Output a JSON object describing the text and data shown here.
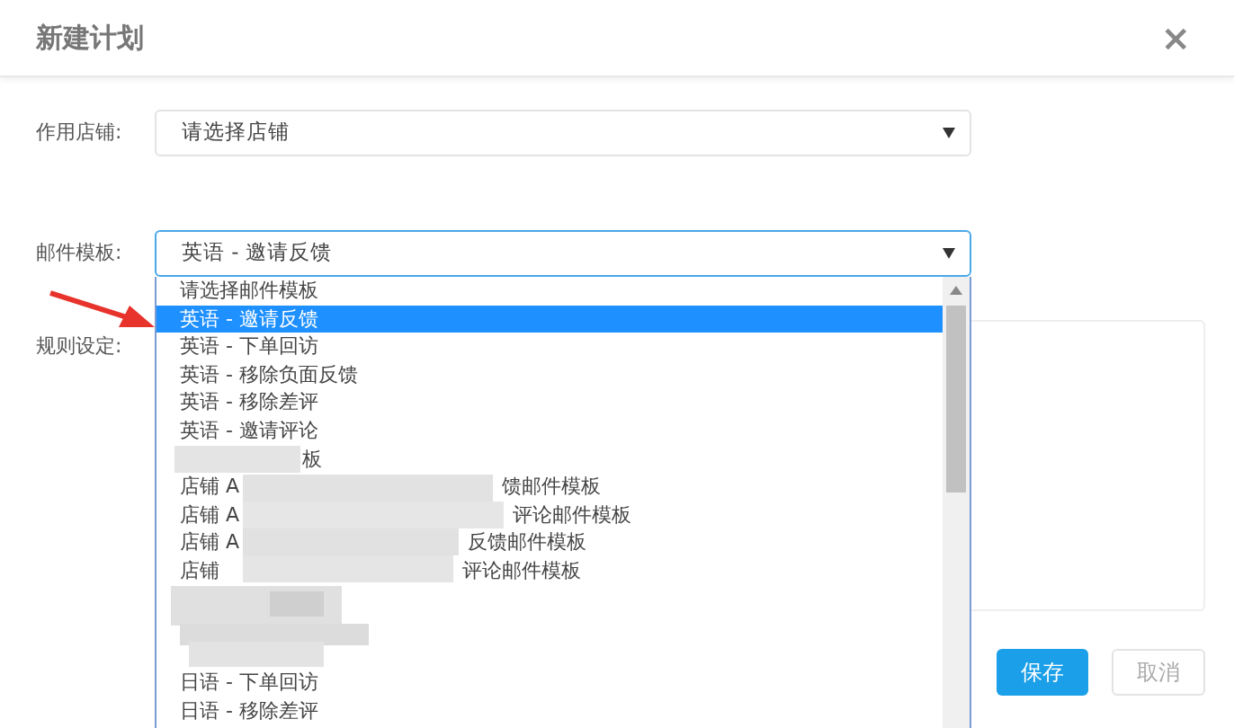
{
  "dialog": {
    "title": "新建计划",
    "close": "×"
  },
  "fields": [
    {
      "label": "作用店铺:",
      "value": "请选择店铺",
      "focused": false
    },
    {
      "label": "邮件模板:",
      "value": "英语 - 邀请反馈",
      "focused": true
    }
  ],
  "dropdown": {
    "items": [
      {
        "kind": "text",
        "text": "请选择邮件模板",
        "selected": false
      },
      {
        "kind": "text",
        "text": "英语 - 邀请反馈",
        "selected": true
      },
      {
        "kind": "text",
        "text": "英语 - 下单回访",
        "selected": false
      },
      {
        "kind": "text",
        "text": "英语 - 移除负面反馈",
        "selected": false
      },
      {
        "kind": "text",
        "text": "英语 - 移除差评",
        "selected": false
      },
      {
        "kind": "text",
        "text": "英语 - 邀请评论",
        "selected": false
      },
      {
        "kind": "partial",
        "right": "板",
        "selected": false
      },
      {
        "kind": "partial",
        "left": "店铺 A",
        "right": "馈邮件模板",
        "selected": false
      },
      {
        "kind": "partial",
        "left": "店铺 A",
        "right": "评论邮件模板",
        "selected": false
      },
      {
        "kind": "partial",
        "left": "店铺 A",
        "right": "反馈邮件模板",
        "selected": false
      },
      {
        "kind": "partial",
        "left": "店铺",
        "right": "评论邮件模板",
        "selected": false
      },
      {
        "kind": "hidden",
        "selected": false
      },
      {
        "kind": "hidden",
        "selected": false
      },
      {
        "kind": "hidden",
        "selected": false
      },
      {
        "kind": "text",
        "text": "日语 - 下单回访",
        "selected": false
      },
      {
        "kind": "text",
        "text": "日语 - 移除差评",
        "selected": false
      }
    ]
  },
  "rules": {
    "label": "规则设定:"
  },
  "buttons": [
    {
      "kind": "primary",
      "label": "保存"
    },
    {
      "kind": "secondary",
      "label": "取消"
    }
  ]
}
